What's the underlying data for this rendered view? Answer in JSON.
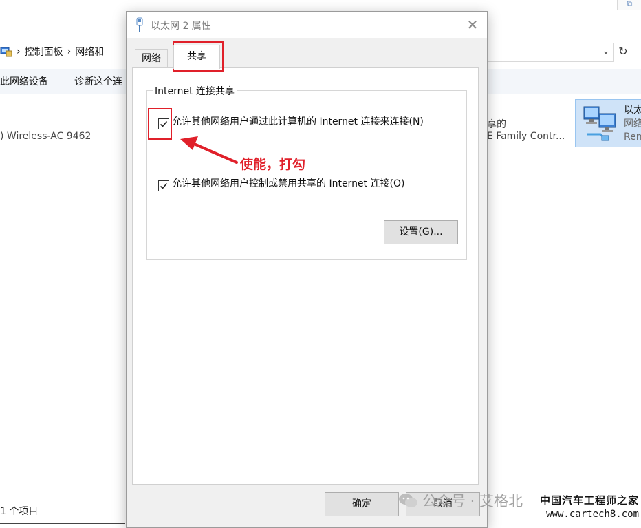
{
  "background_window": {
    "breadcrumb": [
      "控制面板",
      "网络和"
    ],
    "toolbar": {
      "disable_device": "此网络设备",
      "diagnose": "诊断这个连"
    },
    "items": [
      {
        "name_fragment": ") Wireless-AC 9462"
      },
      {
        "status_fragment": "享的",
        "device_fragment": "E Family Contr..."
      }
    ],
    "selected_item": {
      "name": "以太",
      "sub1": "网络",
      "sub2": "Ren"
    },
    "status_bar": "1 个项目"
  },
  "dialog": {
    "title": "以太网 2 属性",
    "close_glyph": "✕",
    "tabs": [
      {
        "label": "网络",
        "active": false
      },
      {
        "label": "共享",
        "active": true
      }
    ],
    "group_title": "Internet 连接共享",
    "checkbox_allow_connect": {
      "label": "允许其他网络用户通过此计算机的 Internet 连接来连接(N)",
      "checked": true
    },
    "checkbox_allow_control": {
      "label": "允许其他网络用户控制或禁用共享的 Internet 连接(O)",
      "checked": true
    },
    "settings_button": "设置(G)...",
    "ok_button": "确定",
    "cancel_button": "取消"
  },
  "annotation": {
    "text": "使能，打勾",
    "color": "#e0202a"
  },
  "watermark": {
    "wechat": "公众号 · 艾格北",
    "site_name": "中国汽车工程师之家",
    "site_url": "www.cartech8.com"
  },
  "colors": {
    "accent_red": "#e0202a",
    "dialog_bg": "#f0f0f0",
    "selection_bg": "#cfe3f8",
    "button_bg": "#e1e1e1"
  },
  "icons": {
    "title": "network-adapter-icon",
    "close": "close-icon",
    "checkbox": "checkmark-icon",
    "network": "network-computers-icon",
    "refresh": "refresh-icon",
    "chevron": "chevron-down-icon"
  }
}
